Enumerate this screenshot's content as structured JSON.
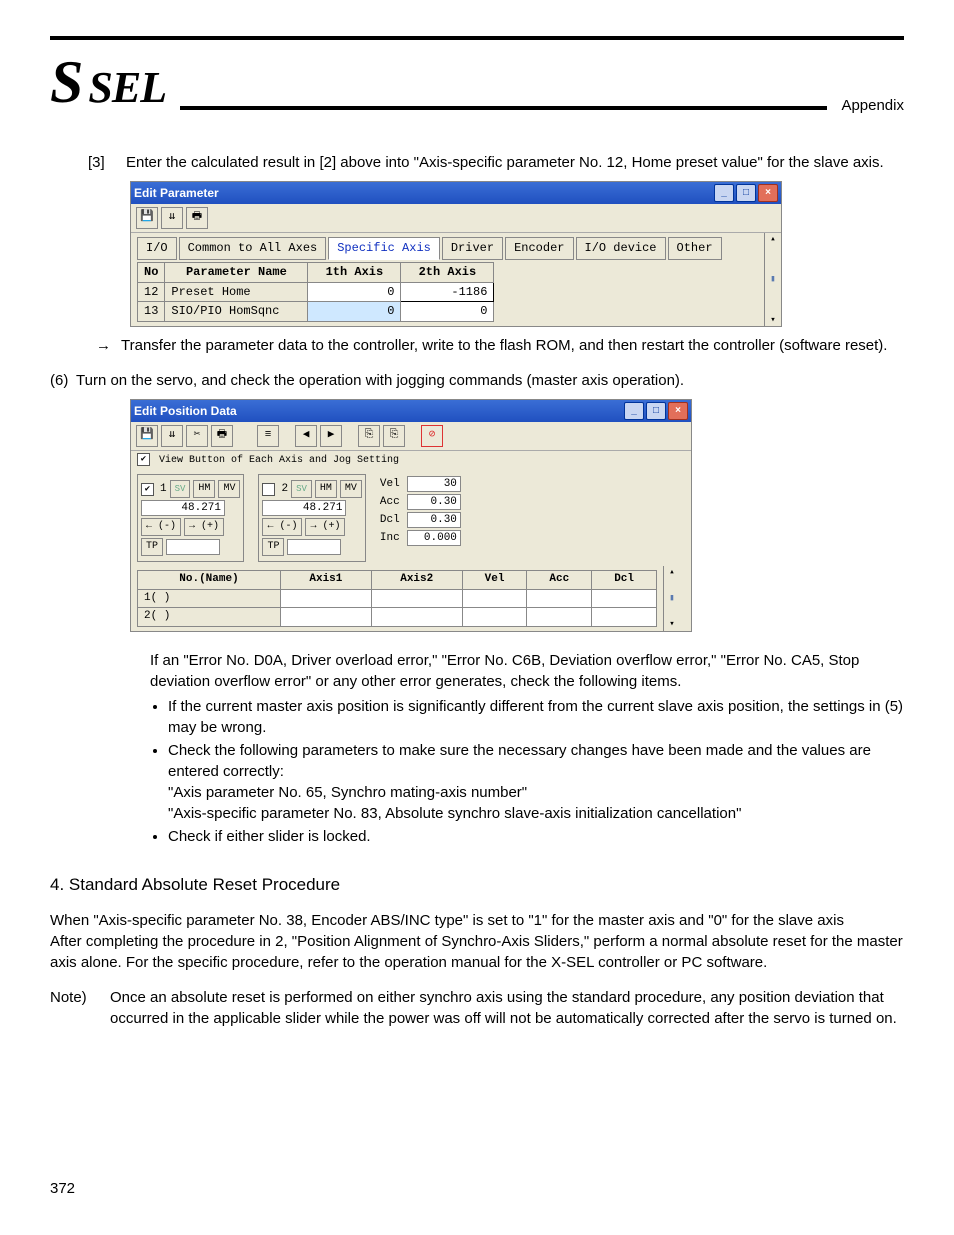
{
  "header": {
    "logo_s": "S",
    "logo_rest": "SEL",
    "appendix": "Appendix"
  },
  "step3": {
    "num": "[3]",
    "text": "Enter the calculated result in [2] above into \"Axis-specific parameter No. 12, Home preset value\" for the slave axis."
  },
  "editParam": {
    "title": "Edit Parameter",
    "tabs": [
      "I/O",
      "Common to All Axes",
      "Specific Axis",
      "Driver",
      "Encoder",
      "I/O device",
      "Other"
    ],
    "cols": [
      "No",
      "Parameter Name",
      "1th Axis",
      "2th Axis"
    ],
    "rows": [
      {
        "no": "12",
        "name": "Preset Home",
        "a1": "0",
        "a2": "-1186"
      },
      {
        "no": "13",
        "name": "SIO/PIO HomSqnc",
        "a1": "0",
        "a2": "0"
      }
    ]
  },
  "transfer": "Transfer the parameter data to the controller, write to the flash ROM, and then restart the controller (software reset).",
  "step6": {
    "num": "(6)",
    "text": "Turn on the servo, and check the operation with jogging commands (master axis operation)."
  },
  "editPos": {
    "title": "Edit Position Data",
    "viewLabel": "View Button of Each Axis and Jog Setting",
    "axis1": {
      "num": "1",
      "pos": "48.271",
      "hm": "HM",
      "mv": "MV",
      "minus": "← (-)",
      "plus": "→ (+)",
      "tp": "TP"
    },
    "axis2": {
      "num": "2",
      "pos": "48.271",
      "hm": "HM",
      "mv": "MV",
      "minus": "← (-)",
      "plus": "→ (+)",
      "tp": "TP"
    },
    "sv": "SV",
    "params": {
      "velLab": "Vel",
      "vel": "30",
      "accLab": "Acc",
      "acc": "0.30",
      "dclLab": "Dcl",
      "dcl": "0.30",
      "incLab": "Inc",
      "inc": "0.000"
    },
    "cols": [
      "No.(Name)",
      "Axis1",
      "Axis2",
      "Vel",
      "Acc",
      "Dcl"
    ],
    "rows": [
      {
        "n": "1(        )"
      },
      {
        "n": "2(        )"
      }
    ]
  },
  "errPara": "If an \"Error No. D0A, Driver overload error,\" \"Error No. C6B, Deviation overflow error,\" \"Error No. CA5, Stop deviation overflow error\" or any other error generates, check the following items.",
  "bul1": "If the current master axis position is significantly different from the current slave axis position, the settings in (5) may be wrong.",
  "bul2a": "Check the following parameters to make sure the necessary changes have been made and the values are entered correctly:",
  "bul2b": "\"Axis parameter No. 65, Synchro mating-axis number\"",
  "bul2c": "\"Axis-specific parameter No. 83, Absolute synchro slave-axis initialization cancellation\"",
  "bul3": "Check if either slider is locked.",
  "sec4": {
    "title": "4.   Standard Absolute Reset Procedure",
    "p1": "When \"Axis-specific parameter No. 38, Encoder ABS/INC type\" is set to \"1\" for the master axis and \"0\" for the slave axis",
    "p2": "After completing the procedure in 2, \"Position Alignment of Synchro-Axis Sliders,\" perform a normal absolute reset for the master axis alone. For the specific procedure, refer to the operation manual for the X-SEL controller or PC software.",
    "noteLab": "Note)",
    "note": "Once an absolute reset is performed on either synchro axis using the standard procedure, any position deviation that occurred in the applicable slider while the power was off will not be automatically corrected after the servo is turned on."
  },
  "pagenum": "372",
  "icons": {
    "min": "_",
    "max": "□",
    "close": "×",
    "up": "▴",
    "dn": "▾",
    "stop": "⊘",
    "left": "◀",
    "right": "▶"
  }
}
